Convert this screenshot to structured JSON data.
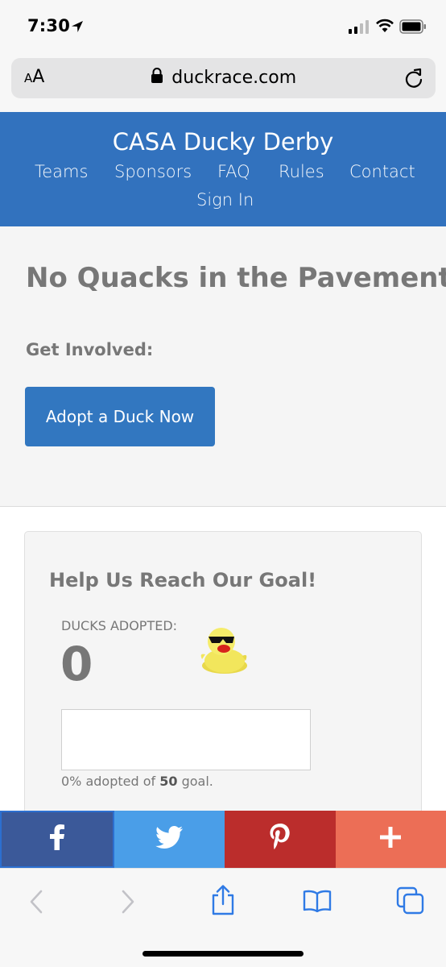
{
  "status_bar": {
    "time": "7:30",
    "icons": [
      "location-arrow-icon",
      "signal-icon",
      "wifi-icon",
      "battery-icon"
    ]
  },
  "address_bar": {
    "aa_label_small": "A",
    "aa_label_large": "A",
    "url": "duckrace.com",
    "icons": [
      "lock-icon",
      "reload-icon"
    ]
  },
  "site_header": {
    "title": "CASA Ducky Derby",
    "nav": [
      "Teams",
      "Sponsors",
      "FAQ",
      "Rules",
      "Contact",
      "Sign In"
    ],
    "color": "#3272be"
  },
  "hero": {
    "title": "No Quacks in the Pavement",
    "subtitle": "Get Involved:",
    "button_label": "Adopt a Duck Now"
  },
  "goal": {
    "title": "Help Us Reach Our Goal!",
    "ducks_label": "DUCKS ADOPTED:",
    "ducks_count": "0",
    "progress_fraction": 0,
    "progress_prefix": "0% adopted of ",
    "goal_value": "50",
    "progress_suffix": " goal."
  },
  "share_bar": {
    "buttons": [
      "facebook-icon",
      "twitter-icon",
      "pinterest-icon",
      "plus-icon"
    ],
    "colors": [
      "#3b5999",
      "#4a9ee8",
      "#bb2d2c",
      "#ec6e56"
    ]
  },
  "toolbar": {
    "icons": [
      "back-icon",
      "forward-icon",
      "share-icon",
      "bookmarks-icon",
      "tabs-icon"
    ]
  }
}
